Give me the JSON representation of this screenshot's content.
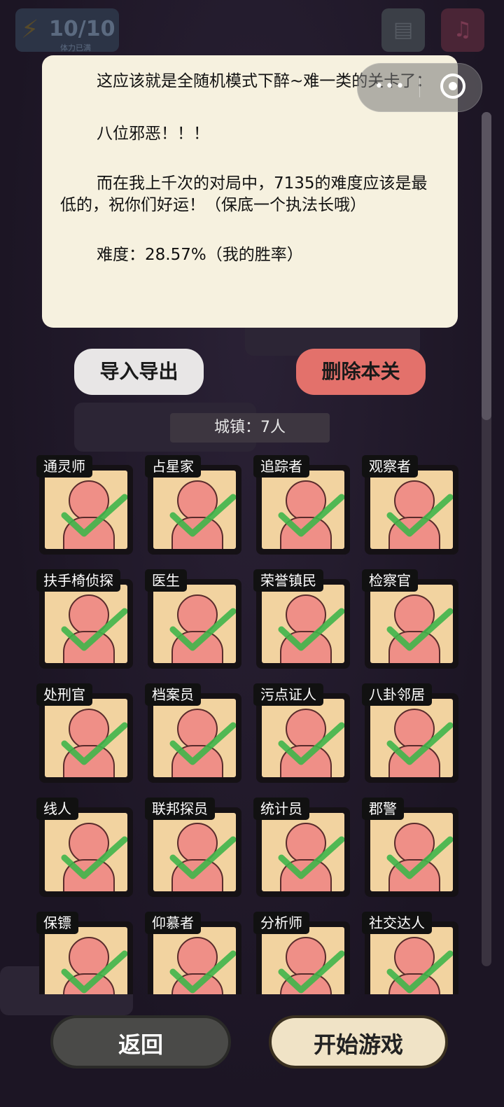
{
  "header": {
    "stamina_value": "10/10",
    "stamina_sub": "体力已满",
    "doc_icon": "document-icon",
    "music_icon": "music-icon"
  },
  "description": {
    "line1": "这应该就是全随机模式下醉~难一类的关卡了：",
    "line2": "八位邪恶！！！",
    "line3": "而在我上千次的对局中，7135的难度应该是最低的，祝你们好运！（保底一个执法长哦）",
    "line4": "难度：28.57%（我的胜率）"
  },
  "actions": {
    "import_export": "导入导出",
    "delete_level": "删除本关"
  },
  "town_label": "城镇：7人",
  "roles": [
    {
      "name": "通灵师",
      "checked": true
    },
    {
      "name": "占星家",
      "checked": true
    },
    {
      "name": "追踪者",
      "checked": true
    },
    {
      "name": "观察者",
      "checked": true
    },
    {
      "name": "扶手椅侦探",
      "checked": true
    },
    {
      "name": "医生",
      "checked": true
    },
    {
      "name": "荣誉镇民",
      "checked": true
    },
    {
      "name": "检察官",
      "checked": true
    },
    {
      "name": "处刑官",
      "checked": true
    },
    {
      "name": "档案员",
      "checked": true
    },
    {
      "name": "污点证人",
      "checked": true
    },
    {
      "name": "八卦邻居",
      "checked": true
    },
    {
      "name": "线人",
      "checked": true
    },
    {
      "name": "联邦探员",
      "checked": true
    },
    {
      "name": "统计员",
      "checked": true
    },
    {
      "name": "郡警",
      "checked": true
    },
    {
      "name": "保镖",
      "checked": true
    },
    {
      "name": "仰慕者",
      "checked": true
    },
    {
      "name": "分析师",
      "checked": true
    },
    {
      "name": "社交达人",
      "checked": true
    }
  ],
  "bottom": {
    "back": "返回",
    "start": "开始游戏"
  },
  "colors": {
    "card_bg": "#f6f1df",
    "delete": "#e3716b",
    "check": "#3fb54a",
    "tile_bg": "#f2d3a0"
  }
}
